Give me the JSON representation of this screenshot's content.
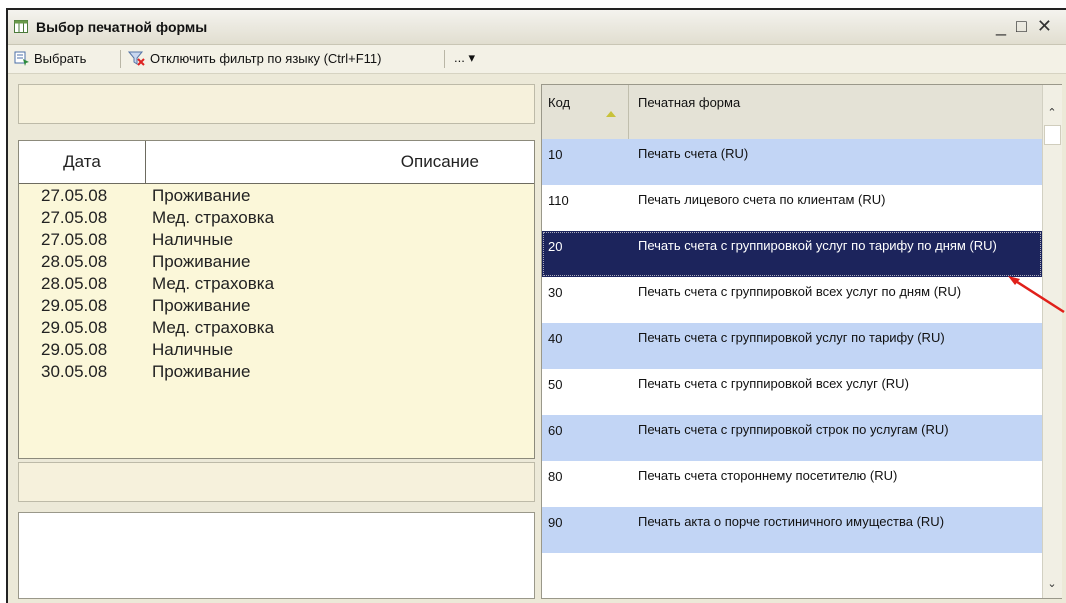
{
  "window": {
    "title": "Выбор печатной формы",
    "controls": {
      "minimize": "_",
      "maximize": "□",
      "close": "✕"
    }
  },
  "toolbar": {
    "select_label": "Выбрать",
    "filter_label": "Отключить фильтр по языку (Ctrl+F11)",
    "more_label": "... ▾"
  },
  "left_table": {
    "columns": [
      "Дата",
      "Описание"
    ],
    "rows": [
      {
        "date": "27.05.08",
        "desc": "Проживание"
      },
      {
        "date": "27.05.08",
        "desc": "Мед. страховка"
      },
      {
        "date": "27.05.08",
        "desc": "Наличные"
      },
      {
        "date": "28.05.08",
        "desc": "Проживание"
      },
      {
        "date": "28.05.08",
        "desc": "Мед. страховка"
      },
      {
        "date": "29.05.08",
        "desc": "Проживание"
      },
      {
        "date": "29.05.08",
        "desc": "Мед. страховка"
      },
      {
        "date": "29.05.08",
        "desc": "Наличные"
      },
      {
        "date": "30.05.08",
        "desc": "Проживание"
      }
    ]
  },
  "right_table": {
    "columns": [
      "Код",
      "Печатная форма"
    ],
    "rows": [
      {
        "code": "10",
        "form": "Печать счета (RU)",
        "style": "blue"
      },
      {
        "code": "110",
        "form": "Печать лицевого счета по клиентам (RU)",
        "style": "white"
      },
      {
        "code": "20",
        "form": "Печать счета с группировкой услуг по тарифу по дням (RU)",
        "style": "sel"
      },
      {
        "code": "30",
        "form": "Печать счета с группировкой всех услуг по дням (RU)",
        "style": "white"
      },
      {
        "code": "40",
        "form": "Печать счета с группировкой услуг по тарифу (RU)",
        "style": "blue"
      },
      {
        "code": "50",
        "form": "Печать счета с группировкой всех услуг (RU)",
        "style": "white"
      },
      {
        "code": "60",
        "form": "Печать счета с группировкой строк по услугам (RU)",
        "style": "blue"
      },
      {
        "code": "80",
        "form": "Печать счета стороннему посетителю (RU)",
        "style": "white"
      },
      {
        "code": "90",
        "form": "Печать акта о порче гостиничного имущества (RU)",
        "style": "blue"
      }
    ]
  },
  "colors": {
    "selected_row": "#1c245c",
    "alt_row": "#c2d5f5",
    "annotation_arrow": "#e0201a"
  }
}
